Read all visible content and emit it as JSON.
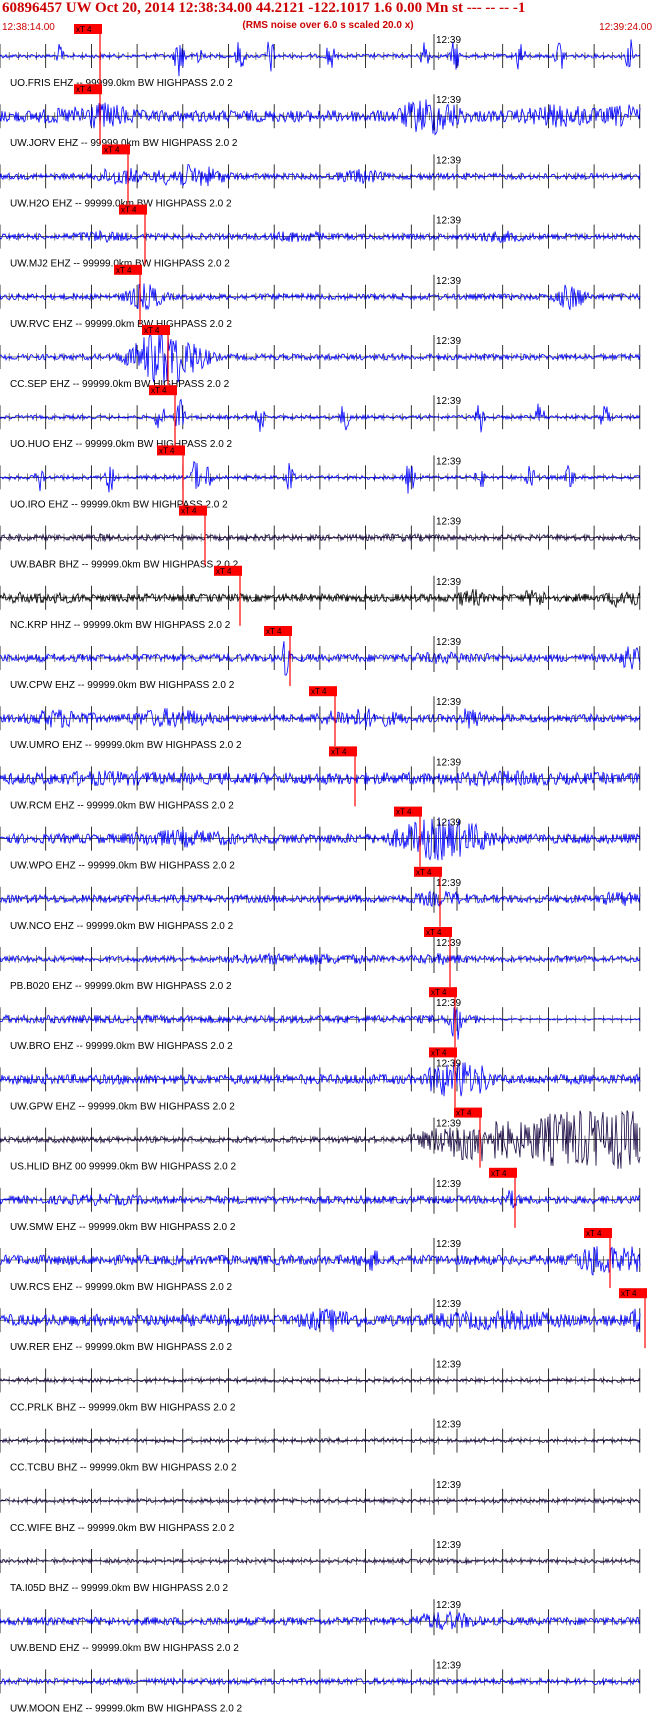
{
  "header": {
    "title": "60896457 UW Oct 20, 2014 12:38:34.00    44.2121 -122.1017  1.6 0.00 Mn st --- -- --  -1",
    "subtitle": "(RMS noise over 6.0 s scaled 20.0 x)",
    "start_time": "12:38:14.00",
    "end_time": "12:39:24.00"
  },
  "colors": {
    "header_text": "#cc0000",
    "trace_blue": "#0000ff",
    "trace_dark": "#1a0a44",
    "trace_black": "#000000",
    "pick_red": "#ff0000",
    "tick_black": "#000000"
  },
  "minute_label": "12:39",
  "pick_label": "xT 4",
  "traces": [
    {
      "label": "UO.FRIS EHZ -- 99999.0km BW  HIGHPASS  2.0  2",
      "color": "blue"
    },
    {
      "label": "UW.JORV EHZ -- 99999.0km BW  HIGHPASS  2.0  2",
      "color": "blue"
    },
    {
      "label": "UW.H2O EHZ -- 99999.0km BW  HIGHPASS  2.0  2",
      "color": "blue"
    },
    {
      "label": "UW.MJ2 EHZ -- 99999.0km BW  HIGHPASS  2.0  2",
      "color": "blue"
    },
    {
      "label": "UW.RVC EHZ -- 99999.0km BW  HIGHPASS  2.0  2",
      "color": "blue"
    },
    {
      "label": "CC.SEP EHZ -- 99999.0km BW  HIGHPASS  2.0  2",
      "color": "blue"
    },
    {
      "label": "UO.HUO EHZ -- 99999.0km BW  HIGHPASS  2.0  2",
      "color": "blue"
    },
    {
      "label": "UO.IRO EHZ -- 99999.0km BW  HIGHPASS  2.0  2",
      "color": "blue"
    },
    {
      "label": "UW.BABR BHZ -- 99999.0km BW  HIGHPASS  2.0  2",
      "color": "dark"
    },
    {
      "label": "NC.KRP HHZ -- 99999.0km BW  HIGHPASS  2.0  2",
      "color": "black"
    },
    {
      "label": "UW.CPW EHZ -- 99999.0km BW  HIGHPASS  2.0  2",
      "color": "blue"
    },
    {
      "label": "UW.UMRO EHZ -- 99999.0km BW  HIGHPASS  2.0  2",
      "color": "blue"
    },
    {
      "label": "UW.RCM EHZ -- 99999.0km BW  HIGHPASS  2.0  2",
      "color": "blue"
    },
    {
      "label": "UW.WPO EHZ -- 99999.0km BW  HIGHPASS  2.0  2",
      "color": "blue"
    },
    {
      "label": "UW.NCO EHZ -- 99999.0km BW  HIGHPASS  2.0  2",
      "color": "blue"
    },
    {
      "label": "PB.B020 EHZ -- 99999.0km BW  HIGHPASS  2.0  2",
      "color": "blue"
    },
    {
      "label": "UW.BRO EHZ -- 99999.0km BW  HIGHPASS  2.0  2",
      "color": "blue"
    },
    {
      "label": "UW.GPW EHZ -- 99999.0km BW  HIGHPASS  2.0  2",
      "color": "blue"
    },
    {
      "label": "US.HLID BHZ 00 99999.0km BW  HIGHPASS  2.0  2",
      "color": "dark"
    },
    {
      "label": "UW.SMW EHZ -- 99999.0km BW  HIGHPASS  2.0  2",
      "color": "blue"
    },
    {
      "label": "UW.RCS EHZ -- 99999.0km BW  HIGHPASS  2.0  2",
      "color": "blue"
    },
    {
      "label": "UW.RER EHZ -- 99999.0km BW  HIGHPASS  2.0  2",
      "color": "blue"
    },
    {
      "label": "CC.PRLK BHZ -- 99999.0km BW  HIGHPASS  2.0  2",
      "color": "dark"
    },
    {
      "label": "CC.TCBU BHZ -- 99999.0km BW  HIGHPASS  2.0  2",
      "color": "dark"
    },
    {
      "label": "CC.WIFE BHZ -- 99999.0km BW  HIGHPASS  2.0  2",
      "color": "dark"
    },
    {
      "label": "TA.I05D BHZ -- 99999.0km BW  HIGHPASS  2.0  2",
      "color": "dark"
    },
    {
      "label": "UW.BEND EHZ -- 99999.0km BW  HIGHPASS  2.0  2",
      "color": "blue"
    },
    {
      "label": "UW.MOON EHZ -- 99999.0km BW  HIGHPASS  2.0  2",
      "color": "blue"
    }
  ]
}
